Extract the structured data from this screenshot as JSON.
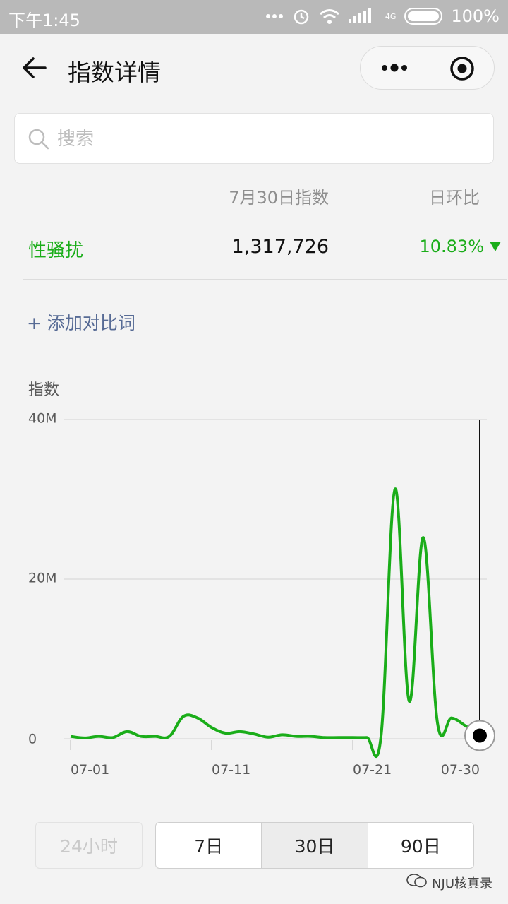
{
  "status_bar": {
    "time": "下午1:45",
    "battery": "100%",
    "network": "4G"
  },
  "nav": {
    "title": "指数详情"
  },
  "search": {
    "placeholder": "搜索"
  },
  "table_header": {
    "index_col": "7月30日指数",
    "change_col": "日环比"
  },
  "keyword_row": {
    "keyword": "性骚扰",
    "index_value": "1,317,726",
    "change": "10.83%",
    "change_direction": "down"
  },
  "add_compare": "+ 添加对比词",
  "colors": {
    "accent_green": "#1aad19",
    "link_blue": "#576b95"
  },
  "chart_data": {
    "type": "line",
    "ylabel": "指数",
    "ylim": [
      0,
      40000000
    ],
    "yticks": [
      "0",
      "20M",
      "40M"
    ],
    "xticks": [
      "07-01",
      "07-11",
      "07-21",
      "07-30"
    ],
    "x": [
      "07-01",
      "07-02",
      "07-03",
      "07-04",
      "07-05",
      "07-06",
      "07-07",
      "07-08",
      "07-09",
      "07-10",
      "07-11",
      "07-12",
      "07-13",
      "07-14",
      "07-15",
      "07-16",
      "07-17",
      "07-18",
      "07-19",
      "07-20",
      "07-21",
      "07-22",
      "07-23",
      "07-24",
      "07-25",
      "07-26",
      "07-27",
      "07-28",
      "07-29",
      "07-30"
    ],
    "values": [
      300000,
      100000,
      300000,
      150000,
      900000,
      300000,
      300000,
      300000,
      2800000,
      2600000,
      1400000,
      700000,
      900000,
      600000,
      200000,
      500000,
      300000,
      300000,
      150000,
      150000,
      150000,
      150000,
      300000,
      31300000,
      4700000,
      25200000,
      2000000,
      2600000,
      1600000,
      400000
    ],
    "grid": true,
    "highlighted_point": "07-30"
  },
  "period_tabs": {
    "disabled": "24小时",
    "options": [
      "7日",
      "30日",
      "90日"
    ],
    "active": "30日"
  },
  "watermark": "NJU核真录"
}
